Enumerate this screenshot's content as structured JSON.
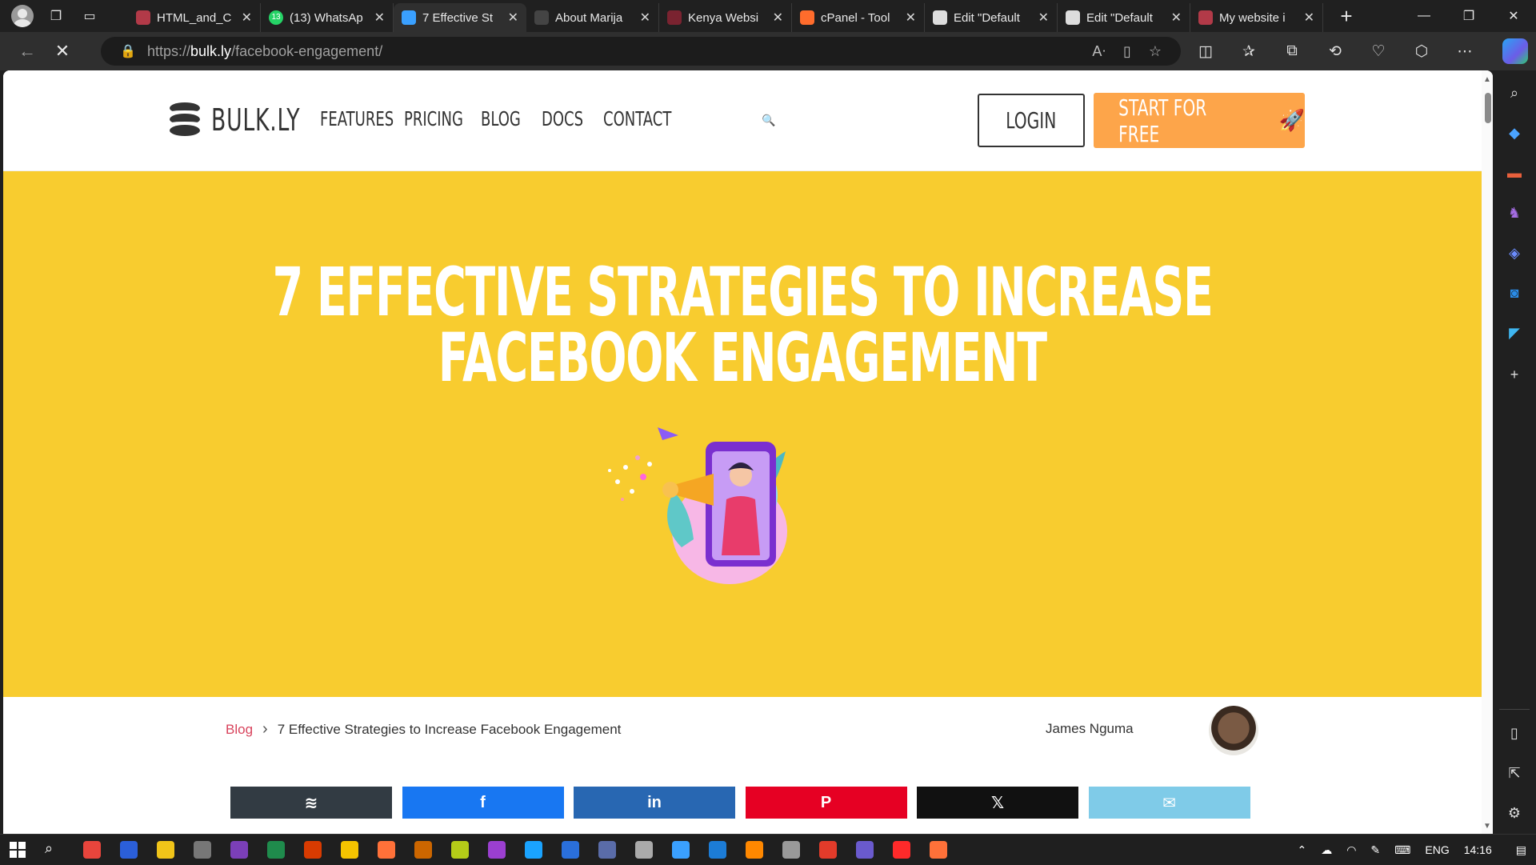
{
  "browser": {
    "tabs": [
      {
        "title": "HTML_and_C",
        "fav_color": "#b23a48",
        "active": false
      },
      {
        "title": "(13) WhatsAp",
        "fav_color": "#25d366",
        "active": false
      },
      {
        "title": "7 Effective St",
        "fav_color": "#3aa0ff",
        "active": true
      },
      {
        "title": "About Marija",
        "fav_color": "#444444",
        "active": false
      },
      {
        "title": "Kenya Websi",
        "fav_color": "#7a2330",
        "active": false
      },
      {
        "title": "cPanel - Tool",
        "fav_color": "#ff6c2c",
        "active": false
      },
      {
        "title": "Edit \"Default",
        "fav_color": "#dddddd",
        "active": false
      },
      {
        "title": "Edit \"Default",
        "fav_color": "#dddddd",
        "active": false
      },
      {
        "title": "My website i",
        "fav_color": "#b23a48",
        "active": false
      }
    ],
    "url": {
      "scheme": "https://",
      "host": "bulk.ly",
      "path": "/facebook-engagement/"
    },
    "whatsapp_badge": "13"
  },
  "site": {
    "logo_text": "BULK.LY",
    "menu": [
      "FEATURES",
      "PRICING",
      "BLOG",
      "DOCS",
      "CONTACT"
    ],
    "login_label": "LOGIN",
    "start_label": "START FOR FREE",
    "start_emoji": "🚀"
  },
  "hero": {
    "title_line1": "7 EFFECTIVE STRATEGIES TO INCREASE",
    "title_line2": "FACEBOOK ENGAGEMENT",
    "bg_color": "#f8cc2f"
  },
  "breadcrumb": {
    "link": "Blog",
    "current": "7 Effective Strategies to Increase Facebook Engagement"
  },
  "author": {
    "name": "James Nguma"
  },
  "share": [
    {
      "name": "buffer",
      "icon": "buffer-icon",
      "color": "#323b43"
    },
    {
      "name": "facebook",
      "icon": "facebook-icon",
      "color": "#1877f2"
    },
    {
      "name": "linkedin",
      "icon": "linkedin-icon",
      "color": "#2867b2"
    },
    {
      "name": "pinterest",
      "icon": "pinterest-icon",
      "color": "#e60023"
    },
    {
      "name": "x",
      "icon": "x-icon",
      "color": "#111111"
    },
    {
      "name": "email",
      "icon": "email-icon",
      "color": "#7fcbe8"
    }
  ],
  "taskbar": {
    "lang": "ENG",
    "time": "14:16"
  }
}
